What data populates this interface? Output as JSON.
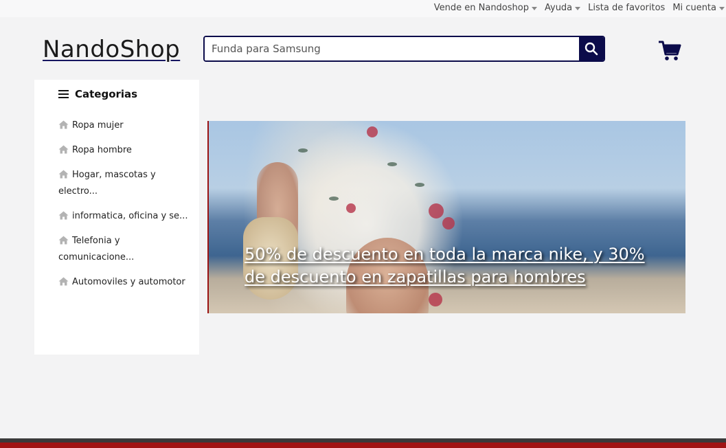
{
  "topnav": {
    "items": [
      {
        "label": "Vende en Nandoshop",
        "dropdown": true
      },
      {
        "label": "Ayuda",
        "dropdown": true
      },
      {
        "label": "Lista de favoritos",
        "dropdown": false
      },
      {
        "label": "Mi cuenta",
        "dropdown": true
      }
    ]
  },
  "header": {
    "logo": "NandoShop",
    "search": {
      "value": "",
      "placeholder": "Funda para Samsung",
      "button_icon": "search-icon"
    },
    "cart_icon": "shopping-cart-icon"
  },
  "sidebar": {
    "title": "Categorias",
    "title_icon": "menu-icon",
    "items": [
      {
        "label": "Ropa mujer",
        "icon": "home-icon"
      },
      {
        "label": "Ropa hombre",
        "icon": "home-icon"
      },
      {
        "label": "Hogar, mascotas y electro...",
        "icon": "home-icon"
      },
      {
        "label": "informatica, oficina y se...",
        "icon": "home-icon"
      },
      {
        "label": "Telefonia y comunicacione...",
        "icon": "home-icon"
      },
      {
        "label": "Automoviles y automotor",
        "icon": "home-icon"
      }
    ]
  },
  "banner": {
    "promo_text": "50% de descuento en toda la marca nike, y 30% de descuento en zapatillas para hombres"
  },
  "colors": {
    "brand_navy": "#0b0b4a",
    "accent_red": "#a01414",
    "background": "#f3f3f4"
  }
}
